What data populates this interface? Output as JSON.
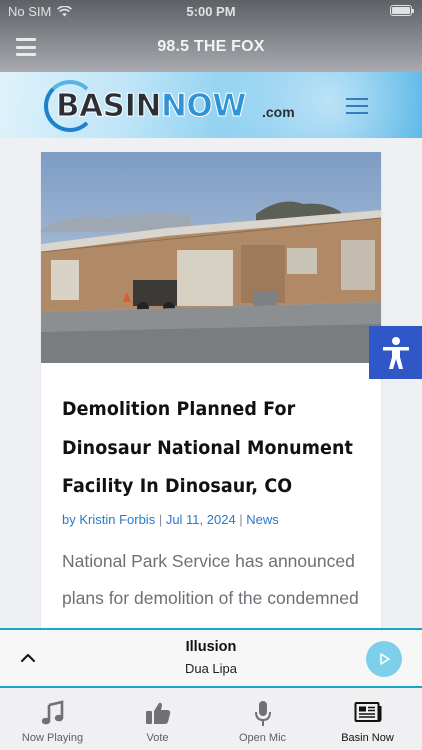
{
  "status_bar": {
    "carrier": "No SIM",
    "time": "5:00 PM"
  },
  "app_header": {
    "title": "98.5 THE FOX"
  },
  "site": {
    "logo_main": "BASIN",
    "logo_accent": "NOW",
    "logo_suffix": ".com"
  },
  "article": {
    "headline": "Demolition Planned For Dinosaur National Monument Facility In Dinosaur, CO",
    "author": "by Kristin Forbis",
    "date": "Jul 11, 2024",
    "category": "News",
    "separator": " | ",
    "excerpt": "National Park Service has announced plans for demolition of the condemned"
  },
  "player": {
    "title": "Illusion",
    "artist": "Dua Lipa"
  },
  "tabs": [
    {
      "label": "Now Playing",
      "icon": "music-note-icon"
    },
    {
      "label": "Vote",
      "icon": "thumbs-up-icon"
    },
    {
      "label": "Open Mic",
      "icon": "microphone-icon"
    },
    {
      "label": "Basin Now",
      "icon": "newspaper-icon"
    }
  ],
  "colors": {
    "accent": "#18a6c9",
    "link": "#2b78c9",
    "a11y": "#2f57c8",
    "play": "#7ecfe9"
  }
}
